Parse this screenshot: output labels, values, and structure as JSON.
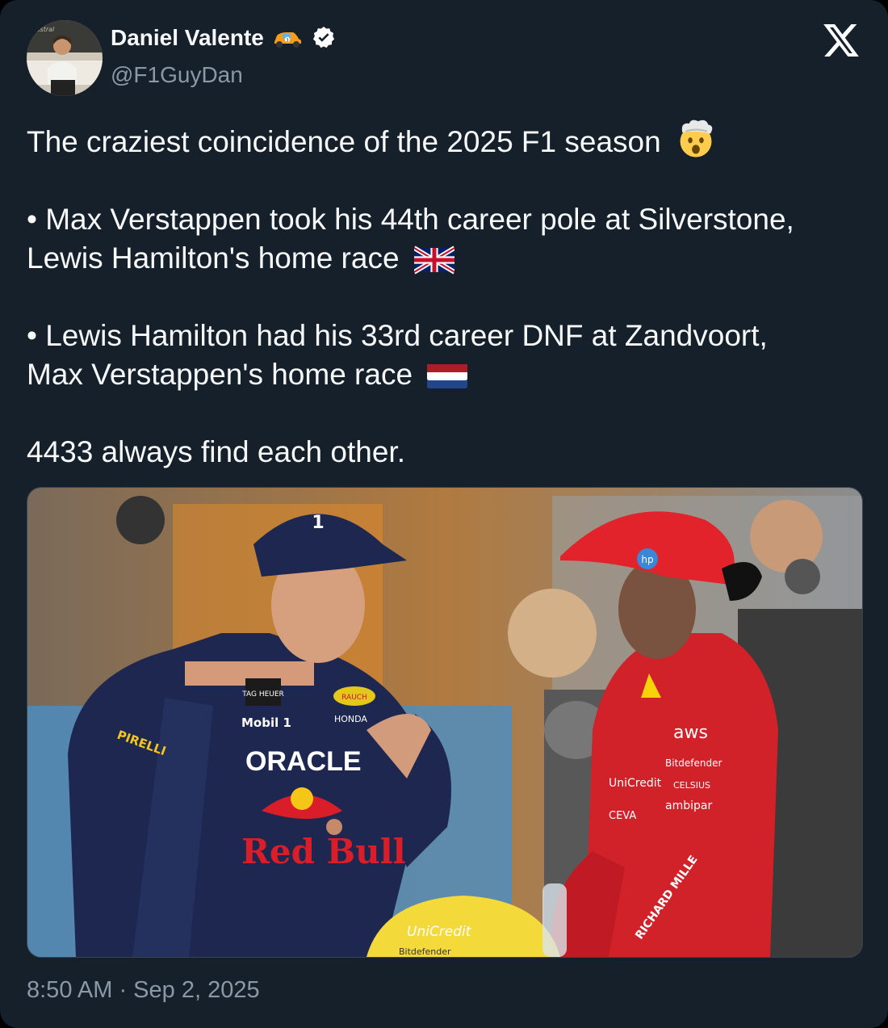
{
  "author": {
    "name": "Daniel Valente",
    "handle": "@F1GuyDan",
    "avatar_icon": "avatar-photo",
    "badges": [
      "race-car-emoji-icon",
      "verified-badge-icon"
    ]
  },
  "brand_icon": "x-logo-icon",
  "tweet": {
    "headline": "The craziest coincidence of the 2025 F1 season",
    "line1_a": "• Max Verstappen took his 44th career pole at Silverstone,",
    "line1_b": "Lewis Hamilton's home race",
    "line2_a": "• Lewis Hamilton had his 33rd career DNF at Zandvoort,",
    "line2_b": "Max Verstappen's home race",
    "closing": "4433 always find each other.",
    "emojis": [
      "exploding-head-emoji",
      "uk-flag-emoji",
      "netherlands-flag-emoji"
    ]
  },
  "media": {
    "sponsor_texts": [
      "ORACLE",
      "Red Bull",
      "Mobil 1",
      "TAG HEUER",
      "HONDA",
      "RAUCH",
      "PIRELLI",
      "aws",
      "Bitdefender",
      "UniCredit",
      "CELSIUS",
      "ambipar",
      "CEVA",
      "RICHARD MILLE",
      "hp"
    ],
    "helmet_number": "1"
  },
  "timestamp": "8:50 AM · Sep 2, 2025",
  "colors": {
    "background": "#15202b",
    "text": "#f7f9f9",
    "secondary": "#8b98a5",
    "verified": "#ffffff"
  }
}
